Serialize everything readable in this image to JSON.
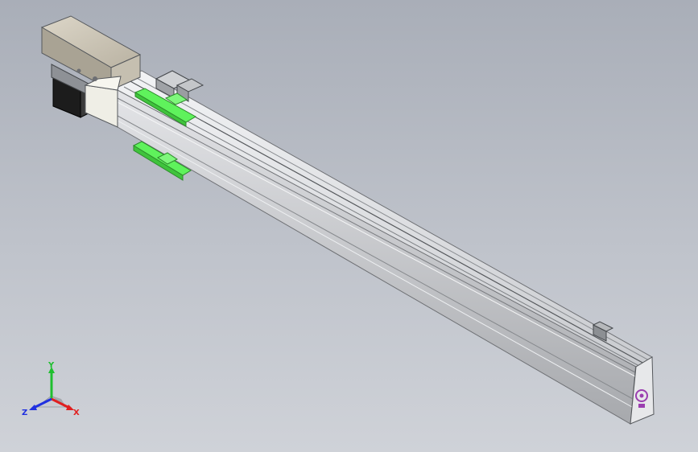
{
  "viewport": {
    "background_top": "#a9aeb8",
    "background_bottom": "#cfd2d8"
  },
  "model": {
    "profile_color": "#d9dbde",
    "profile_shadow": "#8e9196",
    "motor_housing_color": "#c9c3b4",
    "motor_body_color": "#1c1c1c",
    "highlight_part_color": "#5ff25c",
    "logo_color": "#9b3fb0"
  },
  "triad": {
    "x_label": "X",
    "y_label": "Y",
    "z_label": "Z",
    "x_color": "#e02020",
    "y_color": "#1fbf2f",
    "z_color": "#2030e0"
  }
}
